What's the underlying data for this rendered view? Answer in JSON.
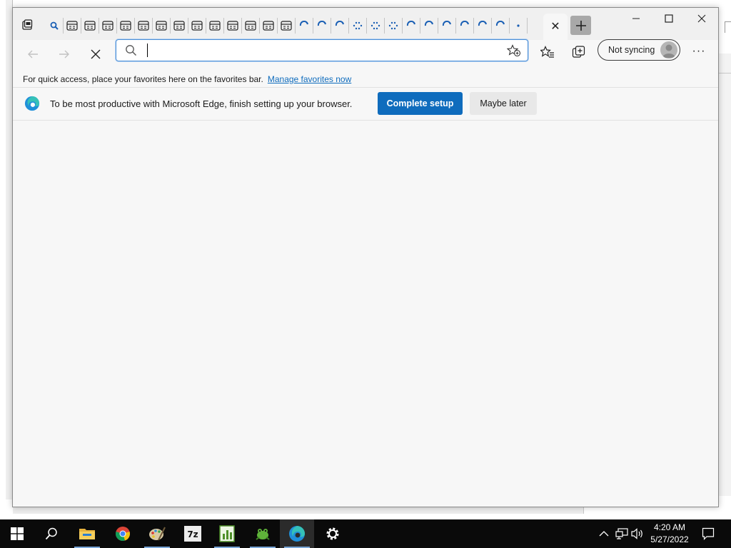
{
  "browser": {
    "active_tab_close_glyph": "✕",
    "new_tab_glyph": "+",
    "address_bar": {
      "value": "",
      "placeholder": ""
    },
    "profile": {
      "label": "Not syncing"
    },
    "more_glyph": "···"
  },
  "favorites_bar": {
    "message": "For quick access, place your favorites here on the favorites bar.",
    "link": "Manage favorites now"
  },
  "infobar": {
    "message": "To be most productive with Microsoft Edge, finish setting up your browser.",
    "primary_button": "Complete setup",
    "secondary_button": "Maybe later"
  },
  "taskbar": {
    "clock_time": "4:20 AM",
    "clock_date": "5/27/2022",
    "apps": [
      "start",
      "search",
      "file-explorer",
      "chrome",
      "paint",
      "7-zip",
      "sheet-app",
      "frog-app",
      "edge",
      "settings"
    ]
  },
  "colors": {
    "accent": "#0f6cbd",
    "taskbar": "#0a0a0a",
    "window_bg": "#f7f7f7"
  }
}
